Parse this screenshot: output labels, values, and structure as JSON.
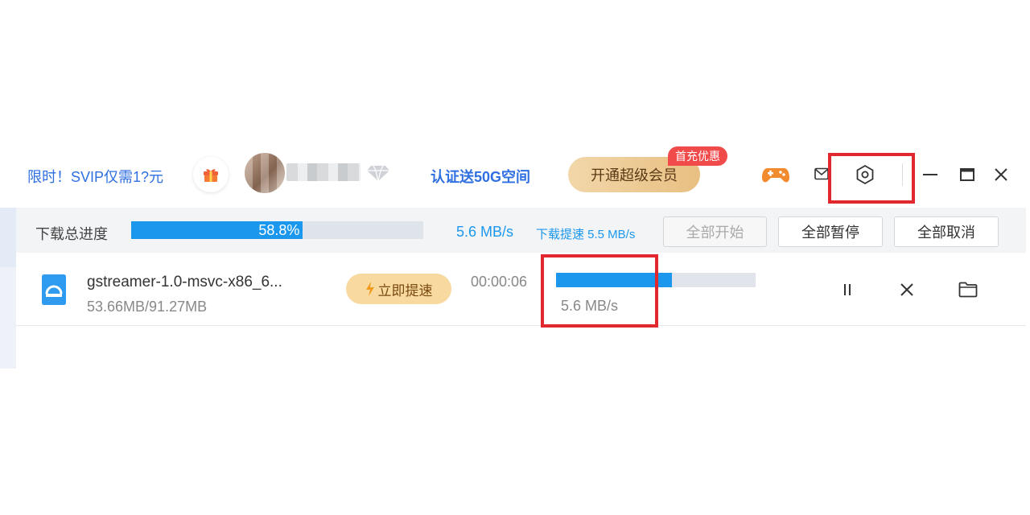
{
  "header": {
    "promo_text": "限时！SVIP仅需1?元",
    "verify_link": "认证送50G空间",
    "svip_button": "开通超级会员",
    "first_charge_badge": "首充优惠"
  },
  "icons": {
    "gift": "gift-icon",
    "diamond": "diamond-icon",
    "game": "gamepad-icon",
    "mail": "mail-icon",
    "settings": "settings-icon",
    "minimize": "minimize-icon",
    "maximize": "maximize-icon",
    "close": "close-icon",
    "file": "installer-file-icon",
    "pause": "pause-icon",
    "cancel": "cancel-icon",
    "folder": "folder-icon",
    "bolt": "lightning-icon"
  },
  "summary": {
    "label": "下载总进度",
    "progress_percent": 58.8,
    "progress_text": "58.8%",
    "speed": "5.6 MB/s",
    "boost_speed": "下载提速 5.5 MB/s",
    "start_all": "全部开始",
    "pause_all": "全部暂停",
    "cancel_all": "全部取消"
  },
  "downloads": [
    {
      "name": "gstreamer-1.0-msvc-x86_6...",
      "size": "53.66MB/91.27MB",
      "boost_button": "立即提速",
      "elapsed": "00:00:06",
      "progress_fraction": 0.58,
      "speed": "5.6 MB/s"
    }
  ],
  "colors": {
    "accent_blue": "#1b98ee",
    "link_blue": "#2f6fe0",
    "highlight_red": "#e0282e",
    "svip_gold": "#e8bf82",
    "badge_red": "#f04a4a"
  }
}
